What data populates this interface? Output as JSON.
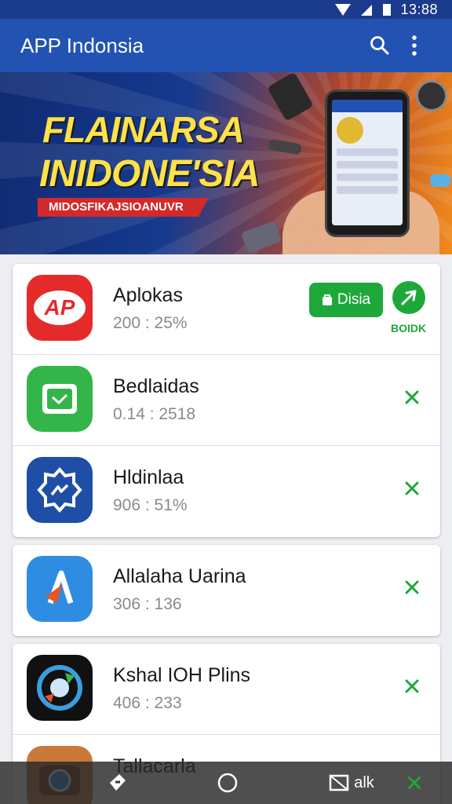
{
  "status": {
    "time": "13:88"
  },
  "appbar": {
    "title": "APP Indonsia",
    "search_icon": "search-icon",
    "menu_icon": "more-vert-icon"
  },
  "banner": {
    "line1": "FLAINARSA",
    "line2": "INIDONE'SIA",
    "ribbon": "MIDOSFIKAJSIOANUVR"
  },
  "apps": [
    {
      "name": "Aplokas",
      "meta": "200 : 25%",
      "icon": "ap-logo-icon",
      "color": "#e52a2a",
      "install_label": "Disia",
      "send_label": "BOIDK"
    },
    {
      "name": "Bedlaidas",
      "meta": "0.14 : 2518",
      "icon": "check-box-icon",
      "color": "#34b54a"
    },
    {
      "name": "Hldinlaa",
      "meta": "906 : 51%",
      "icon": "messenger-badge-icon",
      "color": "#1f4ea6"
    },
    {
      "name": "Allalaha Uarina",
      "meta": "306 : 136",
      "icon": "arrow-logo-icon",
      "color": "#2e8de0"
    },
    {
      "name": "Kshal IOH Plins",
      "meta": "406 : 233",
      "icon": "compass-logo-icon",
      "color": "#111111"
    },
    {
      "name": "Tallacarla",
      "meta": "",
      "icon": "camera-logo-icon",
      "color": "#c97a3a"
    }
  ],
  "navbar": {
    "back_icon": "back-icon",
    "home_icon": "home-icon",
    "recents_icon": "recents-icon",
    "recents_label": "alk"
  },
  "colors": {
    "appbar": "#2253b3",
    "accent_green": "#1fa83a"
  }
}
